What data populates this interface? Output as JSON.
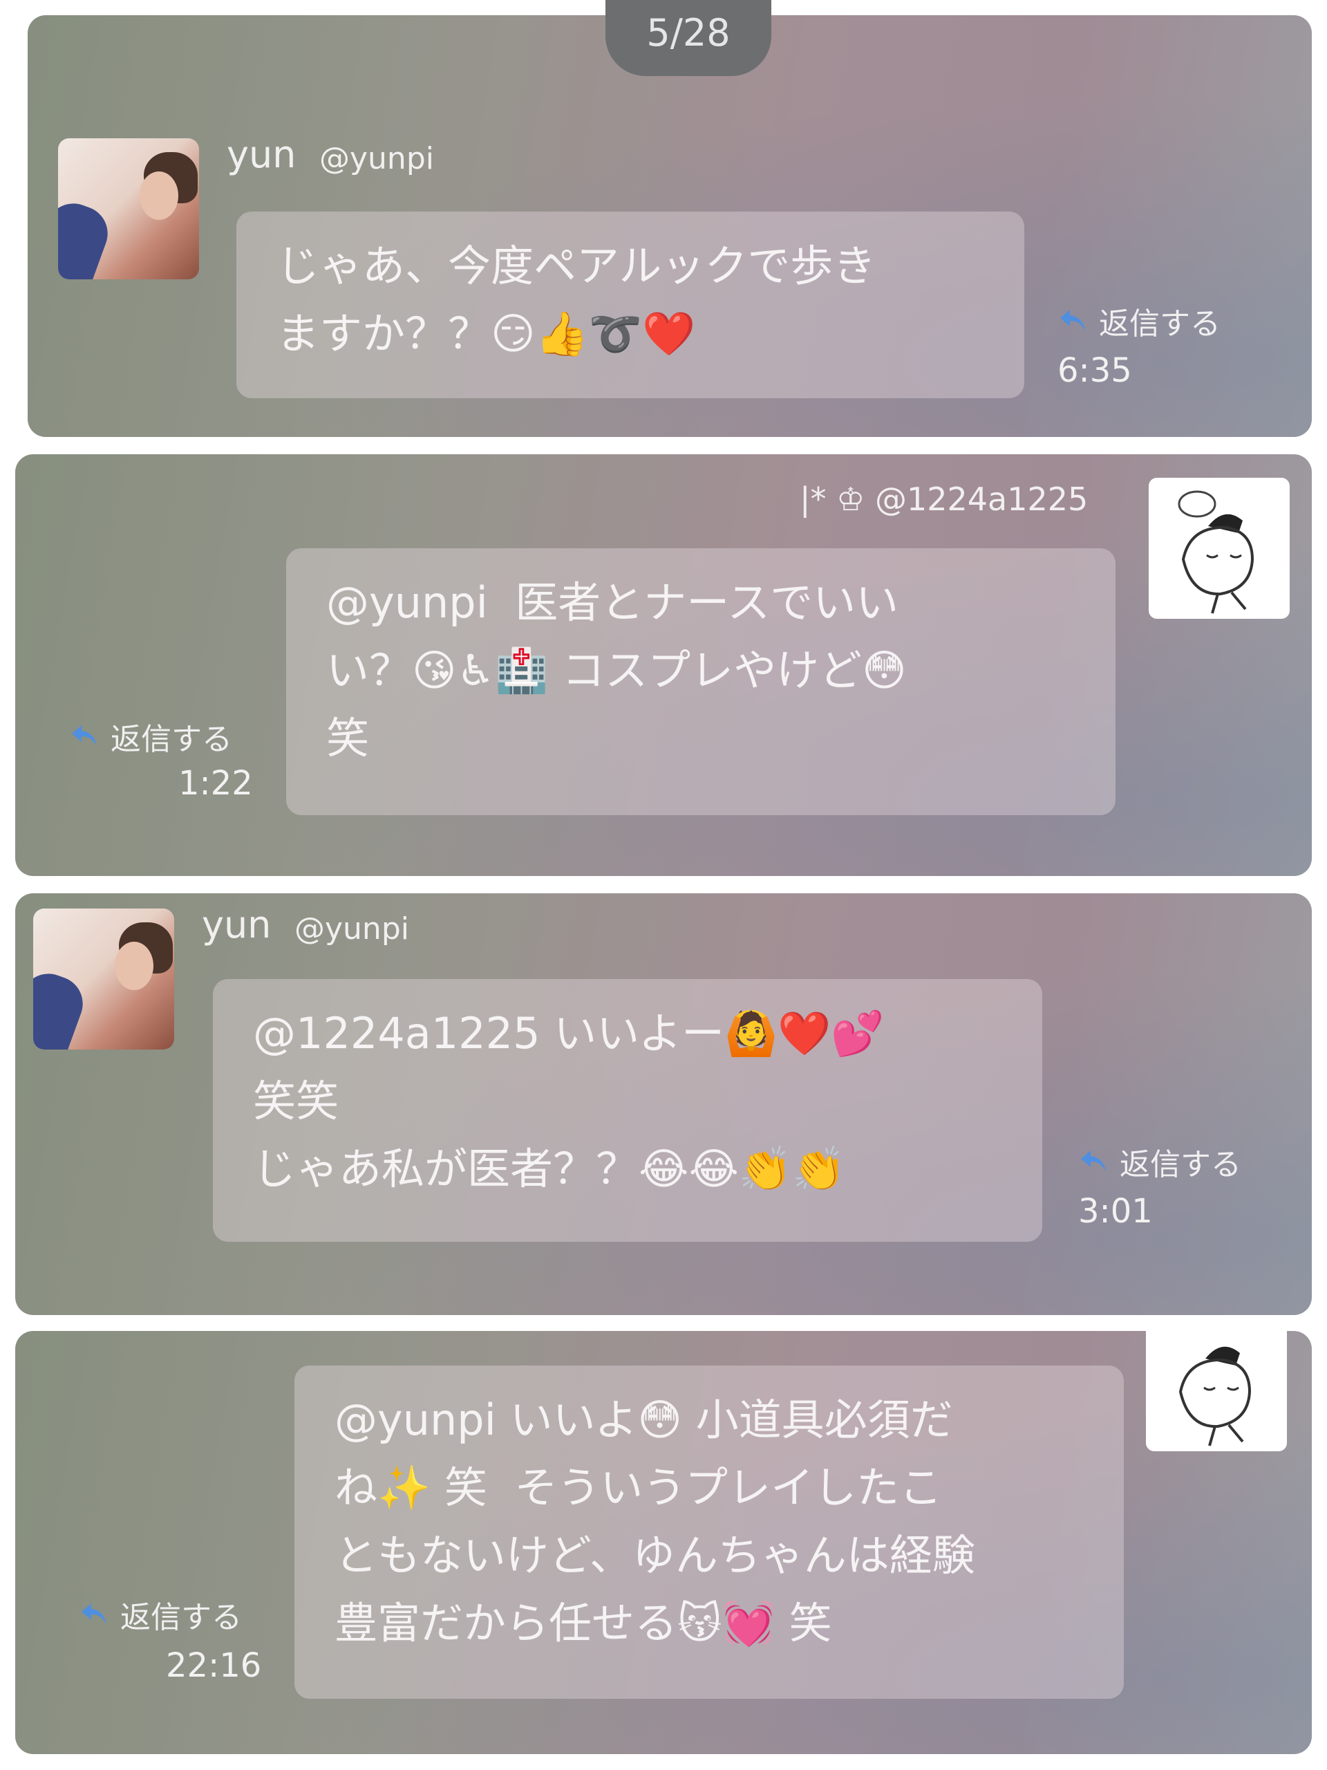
{
  "page_counter": "5/28",
  "messages": [
    {
      "author_name": "yun",
      "author_handle": "@yunpi",
      "text": "じゃあ、今度ペアルックで歩き\nますか？？😏👍➰❤️",
      "reply_label": "返信する",
      "time": "6:35"
    },
    {
      "author_handle": "|* ♔ @1224a1225",
      "text": "@yunpi  医者とナースでいい\nい？😘♿🏥 コスプレやけど😳\n笑",
      "reply_label": "返信する",
      "time": "1:22"
    },
    {
      "author_name": "yun",
      "author_handle": "@yunpi",
      "text": "@1224a1225 いいよー🙆❤️💕\n笑笑\nじゃあ私が医者？？😂😂👏👏",
      "reply_label": "返信する",
      "time": "3:01"
    },
    {
      "text": "@yunpi いいよ😳 小道具必須だ\nね✨ 笑  そういうプレイしたこ\nともないけど、ゆんちゃんは経験\n豊富だから任せる😽💓 笑",
      "reply_label": "返信する",
      "time": "22:16"
    }
  ],
  "colors": {
    "panel_left": "#878f7f",
    "panel_mid": "#a38f96",
    "counter_bg": "#6d6e70",
    "reply_icon": "#4f8fe0"
  },
  "icons": {
    "reply": "reply-arrow-icon",
    "avatar": "user-avatar-photo",
    "sticker": "cartoon-character-sticker"
  }
}
